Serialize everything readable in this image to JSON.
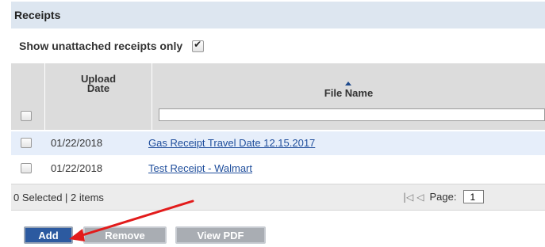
{
  "panel": {
    "title": "Receipts"
  },
  "filter": {
    "unattached_label": "Show unattached receipts only",
    "unattached_checked": true
  },
  "grid": {
    "columns": [
      {
        "label": "Upload Date",
        "line1": "Upload",
        "line2": "Date"
      },
      {
        "label": "File Name",
        "sorted": "ascending"
      }
    ],
    "filter_value": "",
    "rows": [
      {
        "date": "01/22/2018",
        "file_name": "Gas Receipt Travel Date 12.15.2017",
        "selected": false
      },
      {
        "date": "01/22/2018",
        "file_name": "Test Receipt - Walmart",
        "selected": false
      }
    ]
  },
  "footer": {
    "selection_summary": "0 Selected | 2 items",
    "page_label": "Page:",
    "page_value": "1"
  },
  "buttons": {
    "add": "Add",
    "remove": "Remove",
    "view_pdf": "View PDF"
  },
  "annotation": {
    "arrow_color": "#e21b1b"
  },
  "colors": {
    "accent": "#2c5aa0",
    "link": "#1f4e9c",
    "header_bg": "#dde6f0",
    "selected_row_bg": "#e6eefa"
  }
}
